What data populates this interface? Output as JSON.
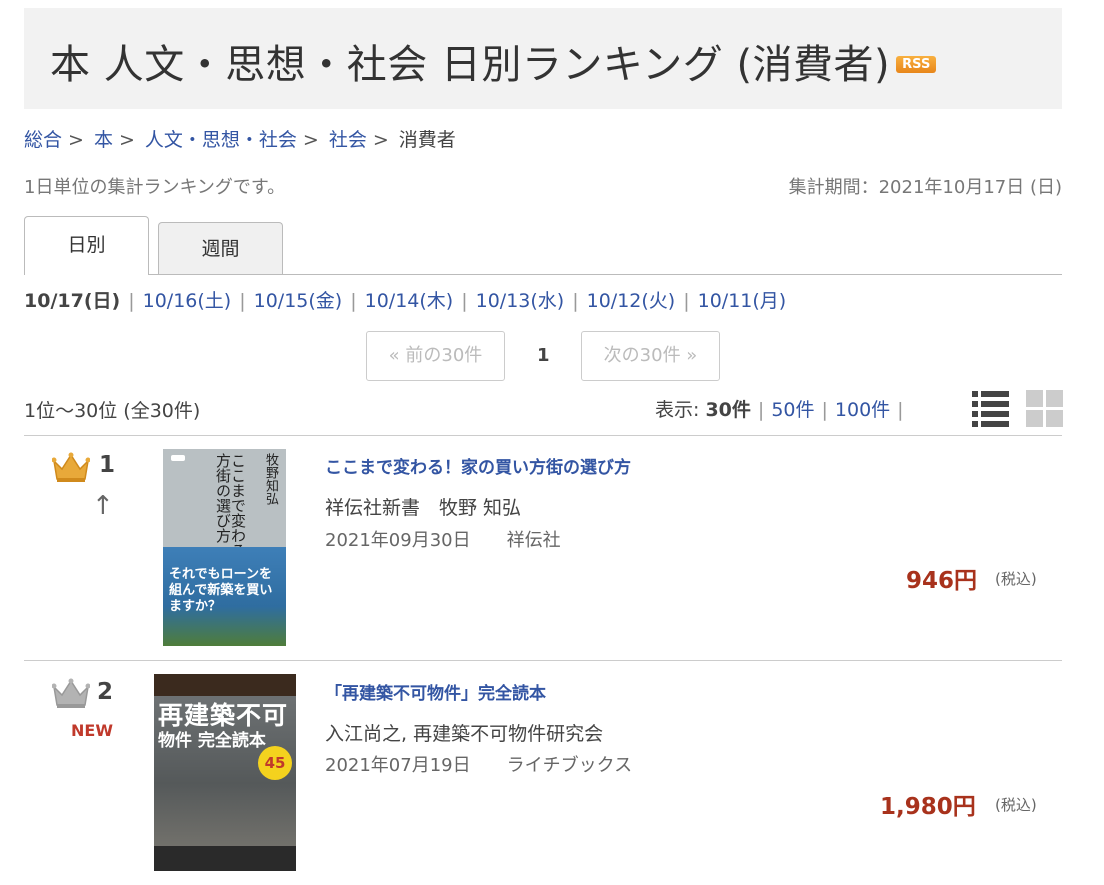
{
  "header": {
    "title": "本 人文・思想・社会 日別ランキング (消費者)",
    "rss_label": "RSS"
  },
  "breadcrumb": {
    "items": [
      "総合",
      "本",
      "人文・思想・社会",
      "社会"
    ],
    "current": "消費者",
    "separator": ">"
  },
  "description": "1日単位の集計ランキングです。",
  "period": "集計期間：2021年10月17日 (日)",
  "tabs": [
    {
      "label": "日別",
      "active": true
    },
    {
      "label": "週間",
      "active": false
    }
  ],
  "dates": [
    "10/17(日)",
    "10/16(土)",
    "10/15(金)",
    "10/14(木)",
    "10/13(水)",
    "10/12(火)",
    "10/11(月)"
  ],
  "pager": {
    "prev": "« 前の30件",
    "current": "1",
    "next": "次の30件 »"
  },
  "range": "1位～30位 (全30件)",
  "display": {
    "label": "表示:",
    "options": [
      "30件",
      "50件",
      "100件"
    ],
    "selected": "30件"
  },
  "icons": {
    "list": "list-view-icon",
    "grid": "grid-view-icon",
    "crown": "crown-icon"
  },
  "colors": {
    "link": "#3355a3",
    "price": "#a8321c",
    "gold": "#e8a93a",
    "silver": "#a9a9a9",
    "new": "#c0392b"
  },
  "items": [
    {
      "rank": "1",
      "movement": "↑",
      "title": "ここまで変わる！家の買い方街の選び方",
      "author": "祥伝社新書　牧野 知弘",
      "date": "2021年09月30日",
      "publisher": "祥伝社",
      "price": "946円",
      "tax": "(税込)",
      "cover": {
        "top_text": "ここまで変わる！家の買い方街の選び方",
        "author": "牧野知弘",
        "band_text": "それでもローンを組んで新築を買いますか？"
      }
    },
    {
      "rank": "2",
      "badge": "NEW",
      "title": "「再建築不可物件」完全読本",
      "author": "入江尚之, 再建築不可物件研究会",
      "date": "2021年07月19日",
      "publisher": "ライチブックス",
      "price": "1,980円",
      "tax": "(税込)",
      "cover": {
        "main_text": "再建築不可",
        "sub_text": "物件 完全読本",
        "badge": "45"
      }
    }
  ]
}
